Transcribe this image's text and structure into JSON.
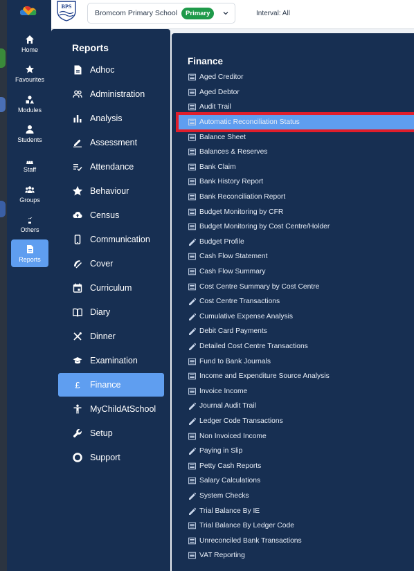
{
  "app": {
    "school_name": "Bromcom Primary School",
    "school_badge": "Primary",
    "interval": "Interval: All",
    "school_logo_text": "BPS"
  },
  "icon_nav": [
    {
      "label": "Home",
      "icon": "home-icon"
    },
    {
      "label": "Favourites",
      "icon": "star-icon"
    },
    {
      "label": "Modules",
      "icon": "modules-icon"
    },
    {
      "label": "Students",
      "icon": "student-icon"
    },
    {
      "label": "Staff",
      "icon": "staff-icon"
    },
    {
      "label": "Groups",
      "icon": "groups-icon"
    },
    {
      "label": "Others",
      "icon": "others-icon"
    },
    {
      "label": "Reports",
      "icon": "report-icon",
      "active": true
    }
  ],
  "reports_menu": {
    "title": "Reports",
    "items": [
      {
        "label": "Adhoc",
        "icon": "document-icon"
      },
      {
        "label": "Administration",
        "icon": "people-icon"
      },
      {
        "label": "Analysis",
        "icon": "bar-chart-icon"
      },
      {
        "label": "Assessment",
        "icon": "pencil-icon"
      },
      {
        "label": "Attendance",
        "icon": "checklist-icon"
      },
      {
        "label": "Behaviour",
        "icon": "star-icon"
      },
      {
        "label": "Census",
        "icon": "cloud-upload-icon"
      },
      {
        "label": "Communication",
        "icon": "mobile-icon"
      },
      {
        "label": "Cover",
        "icon": "cover-icon"
      },
      {
        "label": "Curriculum",
        "icon": "calendar-icon"
      },
      {
        "label": "Diary",
        "icon": "book-icon"
      },
      {
        "label": "Dinner",
        "icon": "cutlery-icon"
      },
      {
        "label": "Examination",
        "icon": "graduation-cap-icon"
      },
      {
        "label": "Finance",
        "icon": "pound-icon",
        "active": true
      },
      {
        "label": "MyChildAtSchool",
        "icon": "child-icon"
      },
      {
        "label": "Setup",
        "icon": "wrench-icon"
      },
      {
        "label": "Support",
        "icon": "support-icon"
      }
    ]
  },
  "finance": {
    "title": "Finance",
    "reports": [
      {
        "label": "Aged Creditor",
        "icon": "list-icon"
      },
      {
        "label": "Aged Debtor",
        "icon": "list-icon"
      },
      {
        "label": "Audit Trail",
        "icon": "list-icon"
      },
      {
        "label": "Automatic Reconciliation Status",
        "icon": "list-icon",
        "highlight": true
      },
      {
        "label": "Balance Sheet",
        "icon": "list-icon"
      },
      {
        "label": "Balances & Reserves",
        "icon": "list-icon"
      },
      {
        "label": "Bank Claim",
        "icon": "list-icon"
      },
      {
        "label": "Bank History Report",
        "icon": "list-icon"
      },
      {
        "label": "Bank Reconciliation Report",
        "icon": "list-icon"
      },
      {
        "label": "Budget Monitoring by CFR",
        "icon": "list-icon"
      },
      {
        "label": "Budget Monitoring by Cost Centre/Holder",
        "icon": "list-icon"
      },
      {
        "label": "Budget Profile",
        "icon": "pencil-icon"
      },
      {
        "label": "Cash Flow Statement",
        "icon": "list-icon"
      },
      {
        "label": "Cash Flow Summary",
        "icon": "list-icon"
      },
      {
        "label": "Cost Centre Summary by Cost Centre",
        "icon": "list-icon"
      },
      {
        "label": "Cost Centre Transactions",
        "icon": "pencil-icon"
      },
      {
        "label": "Cumulative Expense Analysis",
        "icon": "pencil-icon"
      },
      {
        "label": "Debit Card Payments",
        "icon": "pencil-icon"
      },
      {
        "label": "Detailed Cost Centre Transactions",
        "icon": "pencil-icon"
      },
      {
        "label": "Fund to Bank Journals",
        "icon": "list-icon"
      },
      {
        "label": "Income and Expenditure Source Analysis",
        "icon": "list-icon"
      },
      {
        "label": "Invoice Income",
        "icon": "list-icon"
      },
      {
        "label": "Journal Audit Trail",
        "icon": "pencil-icon"
      },
      {
        "label": "Ledger Code Transactions",
        "icon": "pencil-icon"
      },
      {
        "label": "Non Invoiced Income",
        "icon": "list-icon"
      },
      {
        "label": "Paying in Slip",
        "icon": "pencil-icon"
      },
      {
        "label": "Petty Cash Reports",
        "icon": "list-icon"
      },
      {
        "label": "Salary Calculations",
        "icon": "list-icon"
      },
      {
        "label": "System Checks",
        "icon": "pencil-icon"
      },
      {
        "label": "Trial Balance By IE",
        "icon": "pencil-icon"
      },
      {
        "label": "Trial Balance By Ledger Code",
        "icon": "list-icon"
      },
      {
        "label": "Unreconciled Bank Transactions",
        "icon": "list-icon"
      },
      {
        "label": "VAT Reporting",
        "icon": "list-icon"
      }
    ]
  },
  "colors": {
    "nav_bg": "#172f52",
    "active": "#5f9ef0",
    "highlight_border": "#e01e2b",
    "badge": "#1f9a4a"
  }
}
